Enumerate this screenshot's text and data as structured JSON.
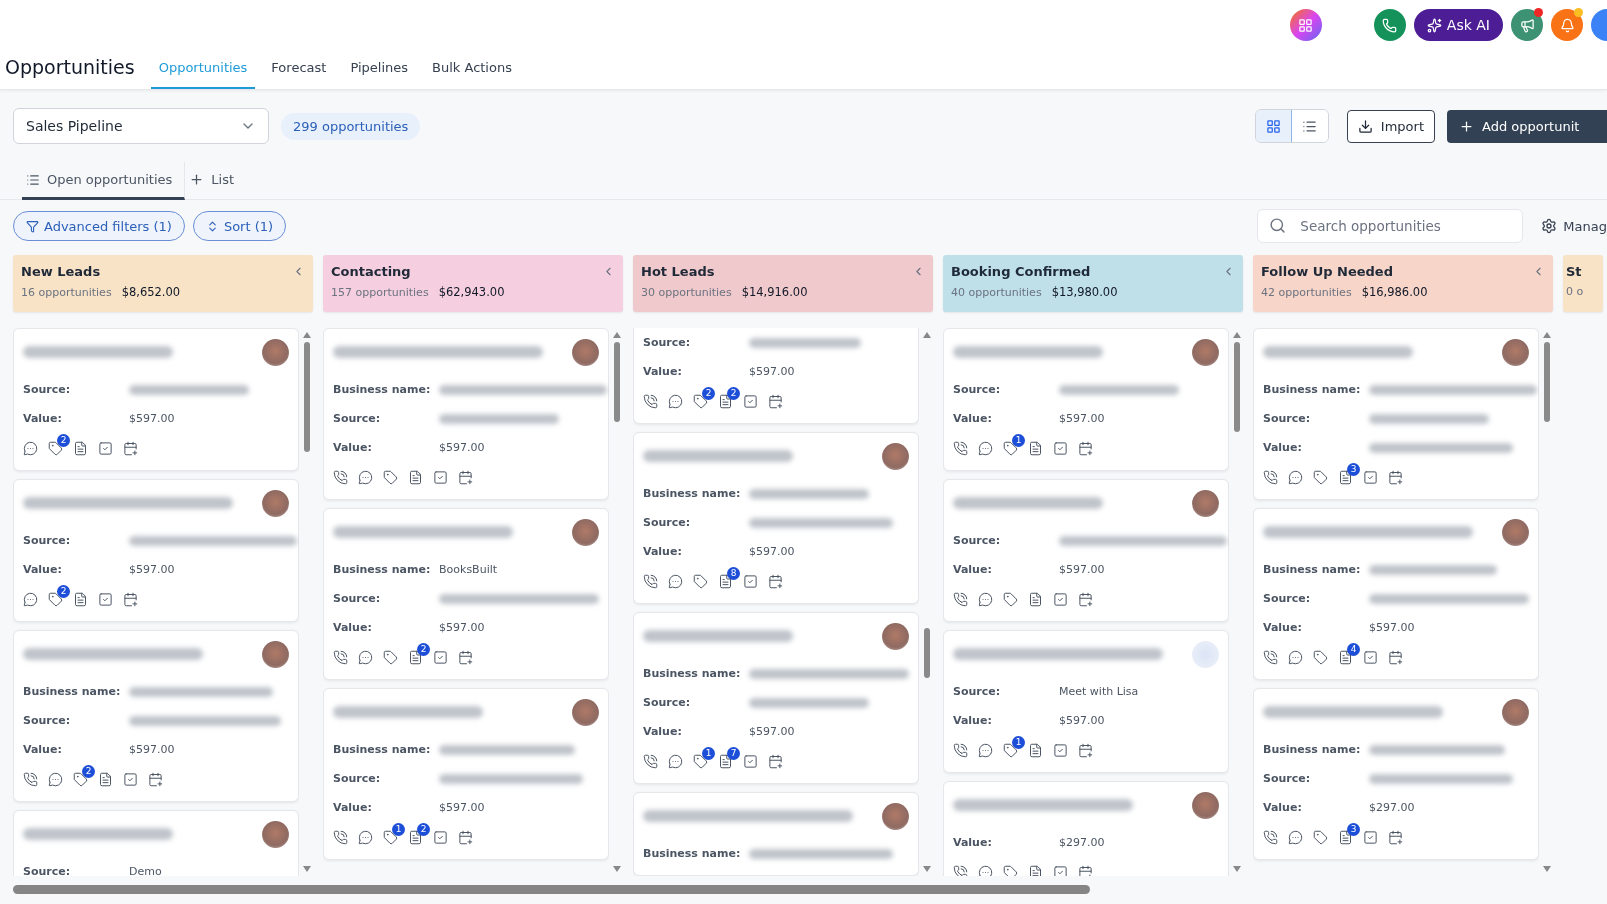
{
  "topbar": {
    "ask_ai": "Ask AI"
  },
  "header": {
    "title": "Opportunities",
    "tabs": [
      {
        "label": "Opportunities",
        "selected": true
      },
      {
        "label": "Forecast",
        "selected": false
      },
      {
        "label": "Pipelines",
        "selected": false
      },
      {
        "label": "Bulk Actions",
        "selected": false
      }
    ]
  },
  "toolbar": {
    "pipeline": "Sales Pipeline",
    "count": "299 opportunities",
    "views": [
      {
        "kind": "grid",
        "selected": true
      },
      {
        "kind": "list",
        "selected": false
      }
    ],
    "import": "Import",
    "add": "Add opportunit"
  },
  "list_tabs": [
    {
      "kind": "list",
      "label": "Open opportunities",
      "selected": true
    },
    {
      "kind": "add",
      "label": "List",
      "selected": false
    }
  ],
  "filters": [
    {
      "kind": "filter",
      "label": "Advanced filters (1)"
    },
    {
      "kind": "sort",
      "label": "Sort (1)"
    }
  ],
  "search": {
    "placeholder": "Search opportunities"
  },
  "manage": "Manag",
  "columns": [
    {
      "title": "New Leads",
      "count": "16 opportunities",
      "amount": "$8,652.00",
      "color": "#f8e3c7",
      "cards": [
        {
          "kind": "full",
          "photo": true,
          "fields": [
            {
              "label": "Source:"
            },
            {
              "label": "Value:",
              "value": "$597.00"
            }
          ],
          "icons": [
            {
              "kind": "sms"
            },
            {
              "kind": "tag",
              "badge": "2"
            },
            {
              "kind": "note"
            },
            {
              "kind": "task"
            },
            {
              "kind": "appointment"
            }
          ]
        },
        {
          "kind": "full",
          "photo": true,
          "fields": [
            {
              "label": "Source:"
            },
            {
              "label": "Value:",
              "value": "$597.00"
            }
          ],
          "icons": [
            {
              "kind": "sms"
            },
            {
              "kind": "tag",
              "badge": "2"
            },
            {
              "kind": "note"
            },
            {
              "kind": "task"
            },
            {
              "kind": "appointment"
            }
          ]
        },
        {
          "kind": "full",
          "photo": true,
          "fields": [
            {
              "label": "Business name:"
            },
            {
              "label": "Source:"
            },
            {
              "label": "Value:",
              "value": "$597.00"
            }
          ],
          "icons": [
            {
              "kind": "call"
            },
            {
              "kind": "sms"
            },
            {
              "kind": "tag",
              "badge": "2"
            },
            {
              "kind": "note"
            },
            {
              "kind": "task"
            },
            {
              "kind": "appointment"
            }
          ]
        },
        {
          "kind": "full",
          "photo": true,
          "fields": [
            {
              "label": "Source:",
              "value": "Demo"
            }
          ]
        }
      ]
    },
    {
      "title": "Contacting",
      "count": "157 opportunities",
      "amount": "$62,943.00",
      "color": "#f5cfe0",
      "cards": [
        {
          "kind": "full",
          "photo": true,
          "fields": [
            {
              "label": "Business name:"
            },
            {
              "label": "Source:"
            },
            {
              "label": "Value:",
              "value": "$597.00"
            }
          ],
          "icons": [
            {
              "kind": "call"
            },
            {
              "kind": "sms"
            },
            {
              "kind": "tag"
            },
            {
              "kind": "note"
            },
            {
              "kind": "task"
            },
            {
              "kind": "appointment"
            }
          ]
        },
        {
          "kind": "full",
          "photo": true,
          "fields": [
            {
              "label": "Business name:",
              "value": "BooksBuilt"
            },
            {
              "label": "Source:"
            },
            {
              "label": "Value:",
              "value": "$597.00"
            }
          ],
          "icons": [
            {
              "kind": "call"
            },
            {
              "kind": "sms"
            },
            {
              "kind": "tag"
            },
            {
              "kind": "note",
              "badge": "2"
            },
            {
              "kind": "task"
            },
            {
              "kind": "appointment"
            }
          ]
        },
        {
          "kind": "full",
          "photo": true,
          "fields": [
            {
              "label": "Business name:"
            },
            {
              "label": "Source:"
            },
            {
              "label": "Value:",
              "value": "$597.00"
            }
          ],
          "icons": [
            {
              "kind": "call"
            },
            {
              "kind": "sms"
            },
            {
              "kind": "tag",
              "badge": "1"
            },
            {
              "kind": "note",
              "badge": "2"
            },
            {
              "kind": "task"
            },
            {
              "kind": "appointment"
            }
          ]
        }
      ]
    },
    {
      "title": "Hot Leads",
      "count": "30 opportunities",
      "amount": "$14,916.00",
      "color": "#f0c9cc",
      "cards": [
        {
          "kind": "partial",
          "fields": [
            {
              "label": "Source:"
            },
            {
              "label": "Value:",
              "value": "$597.00"
            }
          ],
          "icons": [
            {
              "kind": "call"
            },
            {
              "kind": "sms"
            },
            {
              "kind": "tag",
              "badge": "2"
            },
            {
              "kind": "note",
              "badge": "2"
            },
            {
              "kind": "task"
            },
            {
              "kind": "appointment"
            }
          ]
        },
        {
          "kind": "full",
          "photo": true,
          "fields": [
            {
              "label": "Business name:"
            },
            {
              "label": "Source:"
            },
            {
              "label": "Value:",
              "value": "$597.00"
            }
          ],
          "icons": [
            {
              "kind": "call"
            },
            {
              "kind": "sms"
            },
            {
              "kind": "tag"
            },
            {
              "kind": "note",
              "badge": "8"
            },
            {
              "kind": "task"
            },
            {
              "kind": "appointment"
            }
          ]
        },
        {
          "kind": "full",
          "photo": true,
          "fields": [
            {
              "label": "Business name:"
            },
            {
              "label": "Source:"
            },
            {
              "label": "Value:",
              "value": "$597.00"
            }
          ],
          "icons": [
            {
              "kind": "call"
            },
            {
              "kind": "sms"
            },
            {
              "kind": "tag",
              "badge": "1"
            },
            {
              "kind": "note",
              "badge": "7"
            },
            {
              "kind": "task"
            },
            {
              "kind": "appointment"
            }
          ]
        },
        {
          "kind": "full",
          "photo": true,
          "fields": [
            {
              "label": "Business name:"
            }
          ]
        }
      ]
    },
    {
      "title": "Booking Confirmed",
      "count": "40 opportunities",
      "amount": "$13,980.00",
      "color": "#bfe0e8",
      "cards": [
        {
          "kind": "full",
          "photo": true,
          "fields": [
            {
              "label": "Source:"
            },
            {
              "label": "Value:",
              "value": "$597.00"
            }
          ],
          "icons": [
            {
              "kind": "call"
            },
            {
              "kind": "sms"
            },
            {
              "kind": "tag",
              "badge": "1"
            },
            {
              "kind": "note"
            },
            {
              "kind": "task"
            },
            {
              "kind": "appointment"
            }
          ]
        },
        {
          "kind": "full",
          "photo": true,
          "fields": [
            {
              "label": "Source:"
            },
            {
              "label": "Value:",
              "value": "$597.00"
            }
          ],
          "icons": [
            {
              "kind": "call"
            },
            {
              "kind": "sms"
            },
            {
              "kind": "tag"
            },
            {
              "kind": "note"
            },
            {
              "kind": "task"
            },
            {
              "kind": "appointment"
            }
          ]
        },
        {
          "kind": "full",
          "photo": false,
          "fields": [
            {
              "label": "Source:",
              "value": "Meet with Lisa"
            },
            {
              "label": "Value:",
              "value": "$597.00"
            }
          ],
          "icons": [
            {
              "kind": "call"
            },
            {
              "kind": "sms"
            },
            {
              "kind": "tag",
              "badge": "1"
            },
            {
              "kind": "note"
            },
            {
              "kind": "task"
            },
            {
              "kind": "appointment"
            }
          ]
        },
        {
          "kind": "full",
          "photo": true,
          "fields": [
            {
              "label": "Value:",
              "value": "$297.00"
            }
          ],
          "icons": [
            {
              "kind": "call"
            },
            {
              "kind": "sms"
            },
            {
              "kind": "tag"
            },
            {
              "kind": "note"
            },
            {
              "kind": "task"
            },
            {
              "kind": "appointment"
            }
          ]
        }
      ]
    },
    {
      "title": "Follow Up Needed",
      "count": "42 opportunities",
      "amount": "$16,986.00",
      "color": "#f7d5c8",
      "cards": [
        {
          "kind": "full",
          "photo": true,
          "fields": [
            {
              "label": "Business name:"
            },
            {
              "label": "Source:"
            },
            {
              "label": "Value:"
            }
          ],
          "icons": [
            {
              "kind": "call"
            },
            {
              "kind": "sms"
            },
            {
              "kind": "tag"
            },
            {
              "kind": "note",
              "badge": "3"
            },
            {
              "kind": "task"
            },
            {
              "kind": "appointment"
            }
          ]
        },
        {
          "kind": "full",
          "photo": true,
          "fields": [
            {
              "label": "Business name:"
            },
            {
              "label": "Source:"
            },
            {
              "label": "Value:",
              "value": "$597.00"
            }
          ],
          "icons": [
            {
              "kind": "call"
            },
            {
              "kind": "sms"
            },
            {
              "kind": "tag"
            },
            {
              "kind": "note",
              "badge": "4"
            },
            {
              "kind": "task"
            },
            {
              "kind": "appointment"
            }
          ]
        },
        {
          "kind": "full",
          "photo": true,
          "fields": [
            {
              "label": "Business name:"
            },
            {
              "label": "Source:"
            },
            {
              "label": "Value:",
              "value": "$297.00"
            }
          ],
          "icons": [
            {
              "kind": "call"
            },
            {
              "kind": "sms"
            },
            {
              "kind": "tag"
            },
            {
              "kind": "note",
              "badge": "3"
            },
            {
              "kind": "task"
            },
            {
              "kind": "appointment"
            }
          ]
        }
      ]
    },
    {
      "kind": "cut",
      "title": "St",
      "count": "0 o",
      "color": "#f8e3c7"
    }
  ]
}
